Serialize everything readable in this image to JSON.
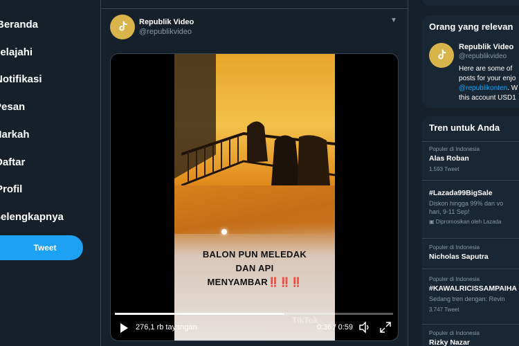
{
  "nav": {
    "items": [
      "Beranda",
      "Jelajahi",
      "Notifikasi",
      "Pesan",
      "Markah",
      "Daftar",
      "Profil",
      "Selengkapnya"
    ],
    "tweet_button": "Tweet"
  },
  "tweet": {
    "author": "Republik Video",
    "handle": "@republikvideo",
    "video": {
      "caption_line1": "BALON PUN MELEDAK",
      "caption_line2": "DAN API",
      "caption_line3": "MENYAMBAR",
      "caption_bangs": "‼️‼️‼️",
      "watermark": "TikTok",
      "views": "276,1 rb tayangan",
      "time": "0:36 / 0:59",
      "progress": 0.61
    }
  },
  "relevant": {
    "title": "Orang yang relevan",
    "name": "Republik Video",
    "handle": "@republikvideo",
    "bio_line1": "Here are some of",
    "bio_line2": "posts for your enjo",
    "bio_link": "@republikonten",
    "bio_line3_suffix": ". W",
    "bio_line4": "this account USD1"
  },
  "trends": {
    "title": "Tren untuk Anda",
    "items": [
      {
        "context": "Populer di Indonesia",
        "name": "Alas Roban",
        "count": "1.593 Tweet"
      },
      {
        "context": "",
        "name": "#Lazada99BigSale",
        "desc1": "Diskon hingga 99% dan vo",
        "desc2": "hari, 9-11 Sep!",
        "promo": "Dipromosikan oleh Lazada"
      },
      {
        "context": "Populer di Indonesia",
        "name": "Nicholas Saputra"
      },
      {
        "context": "Populer di Indonesia",
        "name": "#KAWALRICISSAMPAIHA",
        "desc1": "Sedang tren dengan: Revin",
        "count": "3.747 Tweet"
      },
      {
        "context": "Populer di Indonesia",
        "name": "Rizky Nazar"
      }
    ]
  }
}
